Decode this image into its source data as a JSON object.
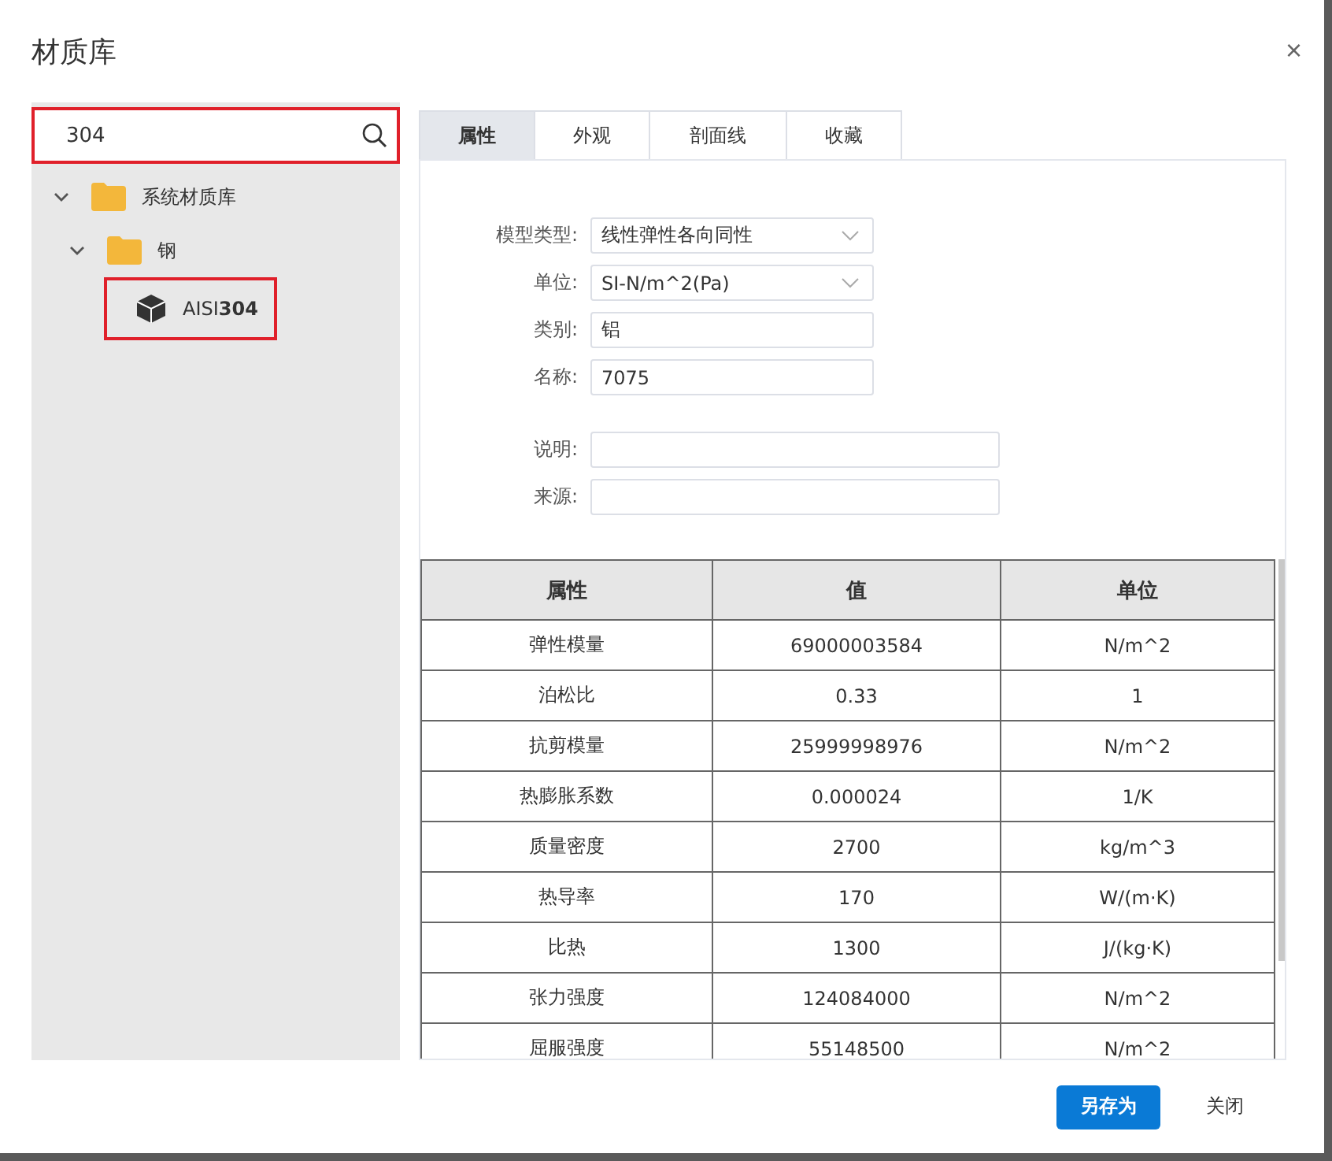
{
  "window": {
    "title": "材质库",
    "close": "×"
  },
  "search": {
    "value": "304",
    "highlighted": true
  },
  "tree": [
    {
      "label": "系统材质库",
      "kind": "folder",
      "expanded": true,
      "highlighted": false,
      "children": [
        {
          "label": "钢",
          "kind": "folder",
          "expanded": true,
          "highlighted": false,
          "children": [
            {
              "label": "AISI**304**",
              "kind": "material",
              "highlighted": true
            }
          ]
        }
      ]
    }
  ],
  "tabs": [
    {
      "label": "属性",
      "selected": true
    },
    {
      "label": "外观",
      "selected": false
    },
    {
      "label": "剖面线",
      "selected": false
    },
    {
      "label": "收藏",
      "selected": false
    }
  ],
  "form": [
    {
      "label": "模型类型:",
      "value": "线性弹性各向同性",
      "kind": "dropdown"
    },
    {
      "label": "单位:",
      "value": "SI-N/m^2(Pa)",
      "kind": "dropdown"
    },
    {
      "label": "类别:",
      "value": "铝",
      "kind": "text"
    },
    {
      "label": "名称:",
      "value": "7075",
      "kind": "text"
    },
    {
      "label": "说明:",
      "kind": "wide"
    },
    {
      "label": "来源:",
      "kind": "wide"
    }
  ],
  "table": {
    "columns": [
      "属性",
      "值",
      "单位"
    ],
    "rows": [
      [
        "弹性模量",
        "69000003584",
        "N/m^2"
      ],
      [
        "泊松比",
        "0.33",
        "1"
      ],
      [
        "抗剪模量",
        "25999998976",
        "N/m^2"
      ],
      [
        "热膨胀系数",
        "0.000024",
        "1/K"
      ],
      [
        "质量密度",
        "2700",
        "kg/m^3"
      ],
      [
        "热导率",
        "170",
        "W/(m·K)"
      ],
      [
        "比热",
        "1300",
        "J/(kg·K)"
      ],
      [
        "张力强度",
        "124084000",
        "N/m^2"
      ],
      [
        "屈服强度",
        "55148500",
        "N/m^2"
      ]
    ]
  },
  "buttons": [
    {
      "label": "另存为",
      "kind": "primary"
    },
    {
      "label": "关闭",
      "kind": "plain"
    }
  ]
}
